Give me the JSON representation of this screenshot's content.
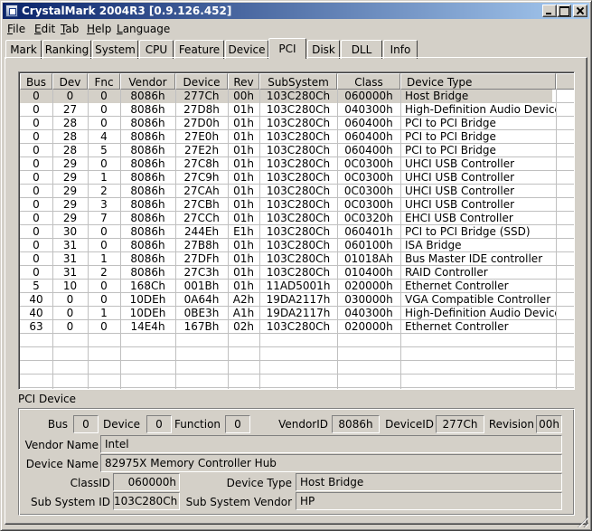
{
  "window": {
    "title": "CrystalMark 2004R3 [0.9.126.452]",
    "icon": "app-icon"
  },
  "menu": [
    {
      "label": "File",
      "accel": "F",
      "rest": "ile"
    },
    {
      "label": "Edit",
      "accel": "E",
      "rest": "dit"
    },
    {
      "label": "Tab",
      "accel": "T",
      "rest": "ab"
    },
    {
      "label": "Help",
      "accel": "H",
      "rest": "elp"
    },
    {
      "label": "Language",
      "accel": "L",
      "rest": "anguage"
    }
  ],
  "tabs": [
    {
      "label": "Mark",
      "active": false
    },
    {
      "label": "Ranking",
      "active": false
    },
    {
      "label": "System",
      "active": false
    },
    {
      "label": "CPU",
      "active": false
    },
    {
      "label": "Feature",
      "active": false
    },
    {
      "label": "Device",
      "active": false
    },
    {
      "label": "PCI",
      "active": true
    },
    {
      "label": "Disk",
      "active": false
    },
    {
      "label": "DLL",
      "active": false
    },
    {
      "label": "Info",
      "active": false
    }
  ],
  "pci_table": {
    "columns": [
      "Bus",
      "Dev",
      "Fnc",
      "Vendor",
      "Device",
      "Rev",
      "SubSystem",
      "Class",
      "Device Type"
    ],
    "selected_row": 0,
    "rows": [
      [
        "0",
        "0",
        "0",
        "8086h",
        "277Ch",
        "00h",
        "103C280Ch",
        "060000h",
        "Host Bridge"
      ],
      [
        "0",
        "27",
        "0",
        "8086h",
        "27D8h",
        "01h",
        "103C280Ch",
        "040300h",
        "High-Definition Audio Device"
      ],
      [
        "0",
        "28",
        "0",
        "8086h",
        "27D0h",
        "01h",
        "103C280Ch",
        "060400h",
        "PCI to PCI Bridge"
      ],
      [
        "0",
        "28",
        "4",
        "8086h",
        "27E0h",
        "01h",
        "103C280Ch",
        "060400h",
        "PCI to PCI Bridge"
      ],
      [
        "0",
        "28",
        "5",
        "8086h",
        "27E2h",
        "01h",
        "103C280Ch",
        "060400h",
        "PCI to PCI Bridge"
      ],
      [
        "0",
        "29",
        "0",
        "8086h",
        "27C8h",
        "01h",
        "103C280Ch",
        "0C0300h",
        "UHCI USB Controller"
      ],
      [
        "0",
        "29",
        "1",
        "8086h",
        "27C9h",
        "01h",
        "103C280Ch",
        "0C0300h",
        "UHCI USB Controller"
      ],
      [
        "0",
        "29",
        "2",
        "8086h",
        "27CAh",
        "01h",
        "103C280Ch",
        "0C0300h",
        "UHCI USB Controller"
      ],
      [
        "0",
        "29",
        "3",
        "8086h",
        "27CBh",
        "01h",
        "103C280Ch",
        "0C0300h",
        "UHCI USB Controller"
      ],
      [
        "0",
        "29",
        "7",
        "8086h",
        "27CCh",
        "01h",
        "103C280Ch",
        "0C0320h",
        "EHCI USB Controller"
      ],
      [
        "0",
        "30",
        "0",
        "8086h",
        "244Eh",
        "E1h",
        "103C280Ch",
        "060401h",
        "PCI to PCI Bridge (SSD)"
      ],
      [
        "0",
        "31",
        "0",
        "8086h",
        "27B8h",
        "01h",
        "103C280Ch",
        "060100h",
        "ISA Bridge"
      ],
      [
        "0",
        "31",
        "1",
        "8086h",
        "27DFh",
        "01h",
        "103C280Ch",
        "01018Ah",
        "Bus Master IDE controller"
      ],
      [
        "0",
        "31",
        "2",
        "8086h",
        "27C3h",
        "01h",
        "103C280Ch",
        "010400h",
        "RAID Controller"
      ],
      [
        "5",
        "10",
        "0",
        "168Ch",
        "001Bh",
        "01h",
        "11AD5001h",
        "020000h",
        "Ethernet Controller"
      ],
      [
        "40",
        "0",
        "0",
        "10DEh",
        "0A64h",
        "A2h",
        "19DA2117h",
        "030000h",
        "VGA Compatible Controller"
      ],
      [
        "40",
        "0",
        "1",
        "10DEh",
        "0BE3h",
        "A1h",
        "19DA2117h",
        "040300h",
        "High-Definition Audio Device"
      ],
      [
        "63",
        "0",
        "0",
        "14E4h",
        "167Bh",
        "02h",
        "103C280Ch",
        "020000h",
        "Ethernet Controller"
      ]
    ]
  },
  "pci_device": {
    "section_title": "PCI Device",
    "labels": {
      "bus": "Bus",
      "device": "Device",
      "function": "Function",
      "vendor_id": "VendorID",
      "device_id": "DeviceID",
      "revision": "Revision",
      "vendor_name": "Vendor Name",
      "device_name": "Device Name",
      "class_id": "ClassID",
      "device_type": "Device Type",
      "sub_system_id": "Sub System ID",
      "sub_system_vendor": "Sub System Vendor"
    },
    "values": {
      "bus": "0",
      "device": "0",
      "function": "0",
      "vendor_id": "8086h",
      "device_id": "277Ch",
      "revision": "00h",
      "vendor_name": "Intel",
      "device_name": "82975X Memory Controller Hub",
      "class_id": "060000h",
      "device_type": "Host Bridge",
      "sub_system_id": "103C280Ch",
      "sub_system_vendor": "HP"
    }
  },
  "colors": {
    "face": "#d4d0c8",
    "title_gradient_start": "#0a246a",
    "title_gradient_end": "#a6caf0",
    "list_background": "#ffffff",
    "grid_line": "#c0c0c0",
    "selected_row": "#d4d0c8"
  }
}
